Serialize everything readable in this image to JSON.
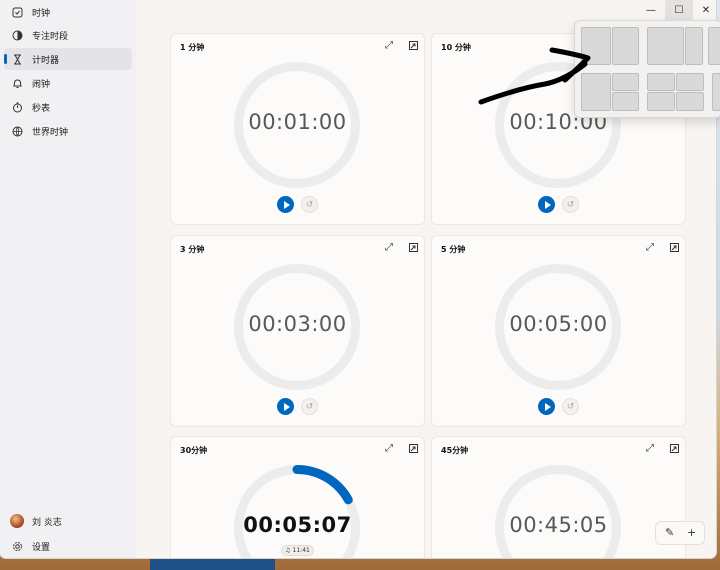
{
  "window": {
    "minimize": "—",
    "maximize": "☐",
    "close": "✕"
  },
  "sidebar": {
    "items": [
      {
        "label": "时钟",
        "icon": "clock-icon"
      },
      {
        "label": "专注时段",
        "icon": "focus-icon"
      },
      {
        "label": "计时器",
        "icon": "hourglass-icon",
        "active": true
      },
      {
        "label": "闹钟",
        "icon": "bell-icon"
      },
      {
        "label": "秒表",
        "icon": "stopwatch-icon"
      },
      {
        "label": "世界时钟",
        "icon": "globe-icon"
      }
    ],
    "user": {
      "name": "刘 炎志"
    },
    "settings": {
      "label": "设置",
      "icon": "gear-icon"
    }
  },
  "timers": [
    {
      "title": "1 分钟",
      "time": "00:01:00",
      "running": false
    },
    {
      "title": "10 分钟",
      "time": "00:10:00",
      "running": false
    },
    {
      "title": "3 分钟",
      "time": "00:03:00",
      "running": false
    },
    {
      "title": "5 分钟",
      "time": "00:05:00",
      "running": false
    },
    {
      "title": "30分钟",
      "time": "00:05:07",
      "running": true,
      "alarm_time": "11:41",
      "progress": 0.17
    },
    {
      "title": "45分钟",
      "time": "00:45:05",
      "running": false
    }
  ],
  "colors": {
    "accent": "#0067c0",
    "annotation": "#000000"
  }
}
